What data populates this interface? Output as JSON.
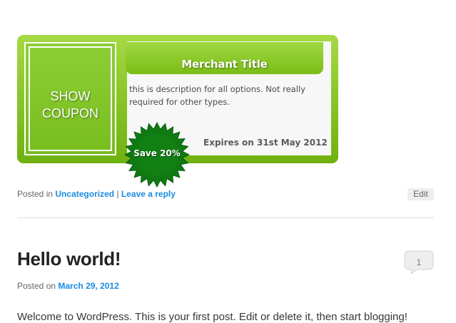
{
  "coupon": {
    "show_label_line1": "SHOW",
    "show_label_line2": "COUPON",
    "merchant_title": "Merchant Title",
    "description": "this is description for all options. Not really required for other types.",
    "expires": "Expires on 31st May 2012",
    "badge": "Save 20%"
  },
  "meta": {
    "posted_in": "Posted in",
    "category": "Uncategorized",
    "separator": "|",
    "reply": "Leave a reply",
    "edit": "Edit"
  },
  "post": {
    "title": "Hello world!",
    "comment_count": "1",
    "posted_on": "Posted on",
    "date": "March 29, 2012",
    "excerpt": "Welcome to WordPress. This is your first post. Edit or delete it, then start blogging!"
  },
  "colors": {
    "accent_green": "#7bbd17",
    "badge_green": "#0f7a12",
    "link_blue": "#1b8be0"
  }
}
